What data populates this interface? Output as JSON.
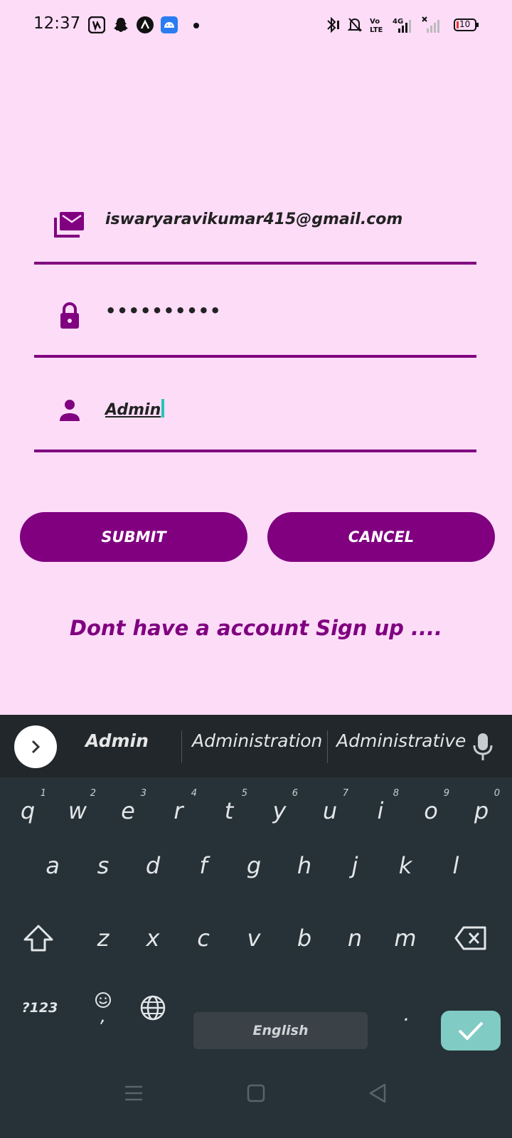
{
  "status_bar": {
    "time": "12:37",
    "app_icons": [
      "saavn-icon",
      "snapchat-icon",
      "app-a-icon",
      "android-icon"
    ],
    "right_icons": [
      "bluetooth-icon",
      "bell-off-icon",
      "volte-icon",
      "signal-4g-icon",
      "signal-no-service-icon",
      "battery-icon"
    ],
    "battery_level": "10",
    "volte_label": "Vo LTE",
    "network_label": "4G"
  },
  "form": {
    "email": {
      "icon": "mail-icon",
      "value": "iswaryaravikumar415@gmail.com"
    },
    "password": {
      "icon": "lock-icon",
      "value": "••••••••••"
    },
    "role": {
      "icon": "person-icon",
      "value": "Admin"
    }
  },
  "buttons": {
    "submit_label": "SUBMIT",
    "cancel_label": "CANCEL"
  },
  "signup_link": "Dont have a account Sign up ....",
  "keyboard": {
    "suggestions": [
      "Admin",
      "Administration",
      "Administrative"
    ],
    "row1": [
      {
        "k": "q",
        "h": "1"
      },
      {
        "k": "w",
        "h": "2"
      },
      {
        "k": "e",
        "h": "3"
      },
      {
        "k": "r",
        "h": "4"
      },
      {
        "k": "t",
        "h": "5"
      },
      {
        "k": "y",
        "h": "6"
      },
      {
        "k": "u",
        "h": "7"
      },
      {
        "k": "i",
        "h": "8"
      },
      {
        "k": "o",
        "h": "9"
      },
      {
        "k": "p",
        "h": "0"
      }
    ],
    "row2": [
      "a",
      "s",
      "d",
      "f",
      "g",
      "h",
      "j",
      "k",
      "l"
    ],
    "row3": [
      "z",
      "x",
      "c",
      "v",
      "b",
      "n",
      "m"
    ],
    "symbols_label": "?123",
    "comma_label": ",",
    "space_label": "English",
    "period_label": ".",
    "colors": {
      "background": "#263238",
      "enter": "#80cbc4"
    }
  },
  "colors": {
    "accent": "#800080",
    "page_background": "#fddcf8"
  }
}
